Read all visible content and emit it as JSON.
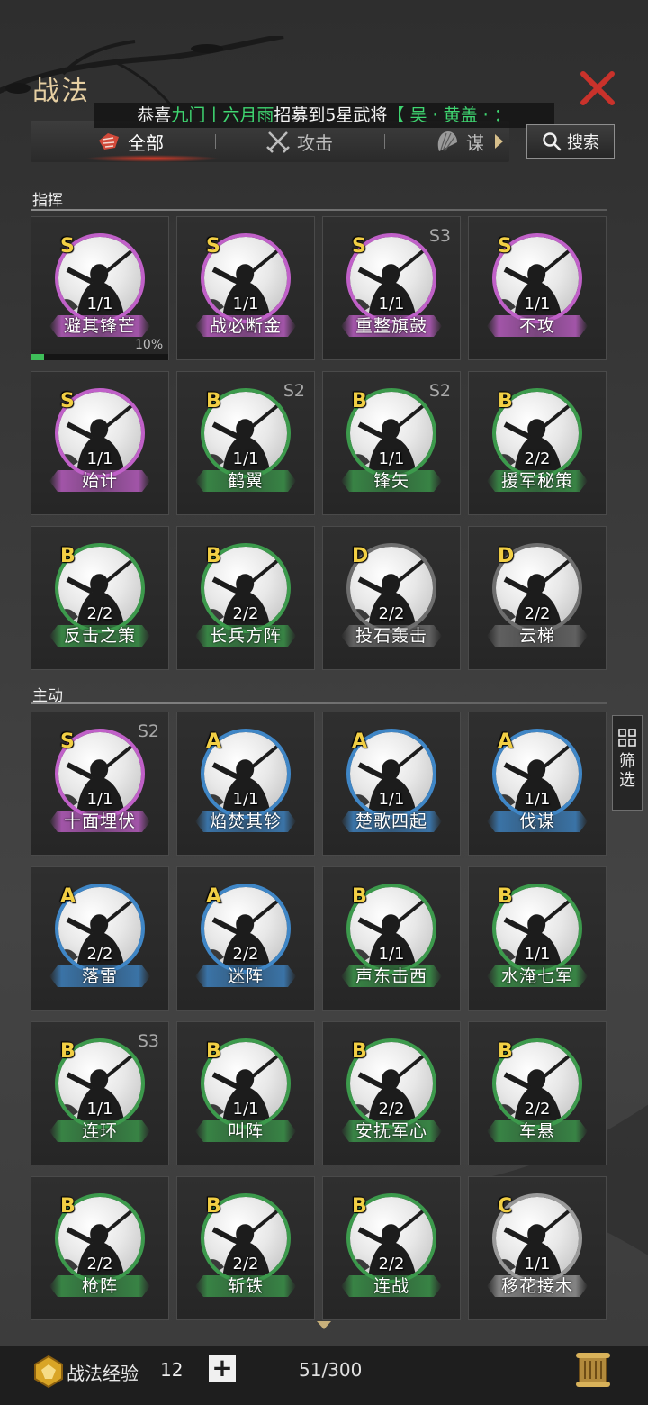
{
  "header": {
    "title": "战法"
  },
  "marquee": {
    "prefix": "恭喜",
    "server": "九门丨六月雨",
    "middle": "招募到5星武将",
    "general": "【 吴 · 黄盖 · ："
  },
  "tabs": [
    {
      "label": "全部",
      "icon": "all-icon"
    },
    {
      "label": "攻击",
      "icon": "crossed-swords-icon"
    },
    {
      "label": "谋",
      "icon": "strategy-fan-icon"
    }
  ],
  "search": {
    "label": "搜索"
  },
  "colors": {
    "S": "#c060c8",
    "A": "#3f86c6",
    "B": "#3c9a4c",
    "C": "#9a9a9a",
    "D": "#6e6e6e",
    "accent": "#3fd671",
    "title": "#e6cfa2"
  },
  "sections": [
    {
      "title": "指挥",
      "cards": [
        {
          "grade": "S",
          "name": "避其锋芒",
          "count": "1/1",
          "season": ""
        },
        {
          "grade": "S",
          "name": "战必断金",
          "count": "1/1",
          "season": ""
        },
        {
          "grade": "S",
          "name": "重整旗鼓",
          "count": "1/1",
          "season": "S3"
        },
        {
          "grade": "S",
          "name": "不攻",
          "count": "1/1",
          "season": ""
        },
        {
          "grade": "S",
          "name": "始计",
          "count": "1/1",
          "season": ""
        },
        {
          "grade": "B",
          "name": "鹤翼",
          "count": "1/1",
          "season": "S2"
        },
        {
          "grade": "B",
          "name": "锋矢",
          "count": "1/1",
          "season": "S2"
        },
        {
          "grade": "B",
          "name": "援军秘策",
          "count": "2/2",
          "season": ""
        },
        {
          "grade": "B",
          "name": "反击之策",
          "count": "2/2",
          "season": ""
        },
        {
          "grade": "B",
          "name": "长兵方阵",
          "count": "2/2",
          "season": ""
        },
        {
          "grade": "D",
          "name": "投石轰击",
          "count": "2/2",
          "season": ""
        },
        {
          "grade": "D",
          "name": "云梯",
          "count": "2/2",
          "season": ""
        }
      ]
    },
    {
      "title": "主动",
      "cards": [
        {
          "grade": "S",
          "name": "十面埋伏",
          "count": "1/1",
          "season": "S2"
        },
        {
          "grade": "A",
          "name": "焰焚其轸",
          "count": "1/1",
          "season": ""
        },
        {
          "grade": "A",
          "name": "楚歌四起",
          "count": "1/1",
          "season": ""
        },
        {
          "grade": "A",
          "name": "伐谋",
          "count": "1/1",
          "season": ""
        },
        {
          "grade": "A",
          "name": "落雷",
          "count": "2/2",
          "season": ""
        },
        {
          "grade": "A",
          "name": "迷阵",
          "count": "2/2",
          "season": ""
        },
        {
          "grade": "B",
          "name": "声东击西",
          "count": "1/1",
          "season": ""
        },
        {
          "grade": "B",
          "name": "水淹七军",
          "count": "1/1",
          "season": ""
        },
        {
          "grade": "B",
          "name": "连环",
          "count": "1/1",
          "season": "S3"
        },
        {
          "grade": "B",
          "name": "叫阵",
          "count": "1/1",
          "season": ""
        },
        {
          "grade": "B",
          "name": "安抚军心",
          "count": "2/2",
          "season": ""
        },
        {
          "grade": "B",
          "name": "车悬",
          "count": "2/2",
          "season": ""
        },
        {
          "grade": "B",
          "name": "枪阵",
          "count": "2/2",
          "season": ""
        },
        {
          "grade": "B",
          "name": "斩铁",
          "count": "2/2",
          "season": ""
        },
        {
          "grade": "B",
          "name": "连战",
          "count": "2/2",
          "season": ""
        },
        {
          "grade": "C",
          "name": "移花接木",
          "count": "1/1",
          "season": ""
        }
      ]
    }
  ],
  "progress": {
    "value": 0.1,
    "label": "10%"
  },
  "filter": {
    "label": "筛选"
  },
  "footer": {
    "exp_label": "战法经验",
    "exp_value": "12",
    "plus_label": "+",
    "slots": "51/300"
  }
}
